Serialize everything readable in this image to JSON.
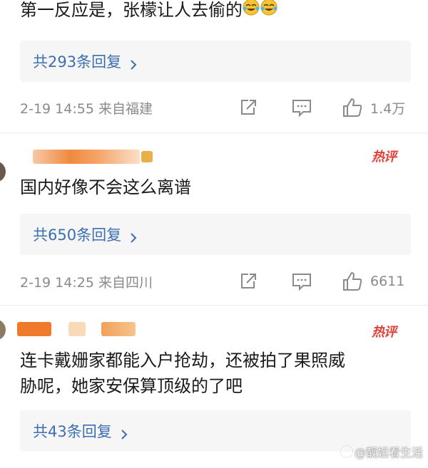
{
  "comments": [
    {
      "text": "第一反应是，张檬让人去偷的",
      "reply_label": "共293条回复",
      "time_location": "2-19 14:55 来自福建",
      "likes": "1.4万"
    },
    {
      "hot_label": "热评",
      "text": "国内好像不会这么离谱",
      "reply_label": "共650条回复",
      "time_location": "2-19 14:25 来自四川",
      "likes": "6611"
    },
    {
      "hot_label": "热评",
      "text_line1": "连卡戴姗家都能入户抢劫，还被拍了果照威",
      "text_line2": "胁呢，她家安保算顶级的了吧",
      "reply_label": "共43条回复"
    }
  ],
  "watermark": "@靓姐看生活",
  "icons": {
    "share": "share-icon",
    "comment": "comment-icon",
    "like": "thumbs-up-icon",
    "reply_arrow": "chevron-right-icon",
    "emoji": "crying-laughing-emoji"
  },
  "colors": {
    "link": "#3b6fb1",
    "hot": "#e0413a",
    "meta": "#8a8a8a"
  }
}
